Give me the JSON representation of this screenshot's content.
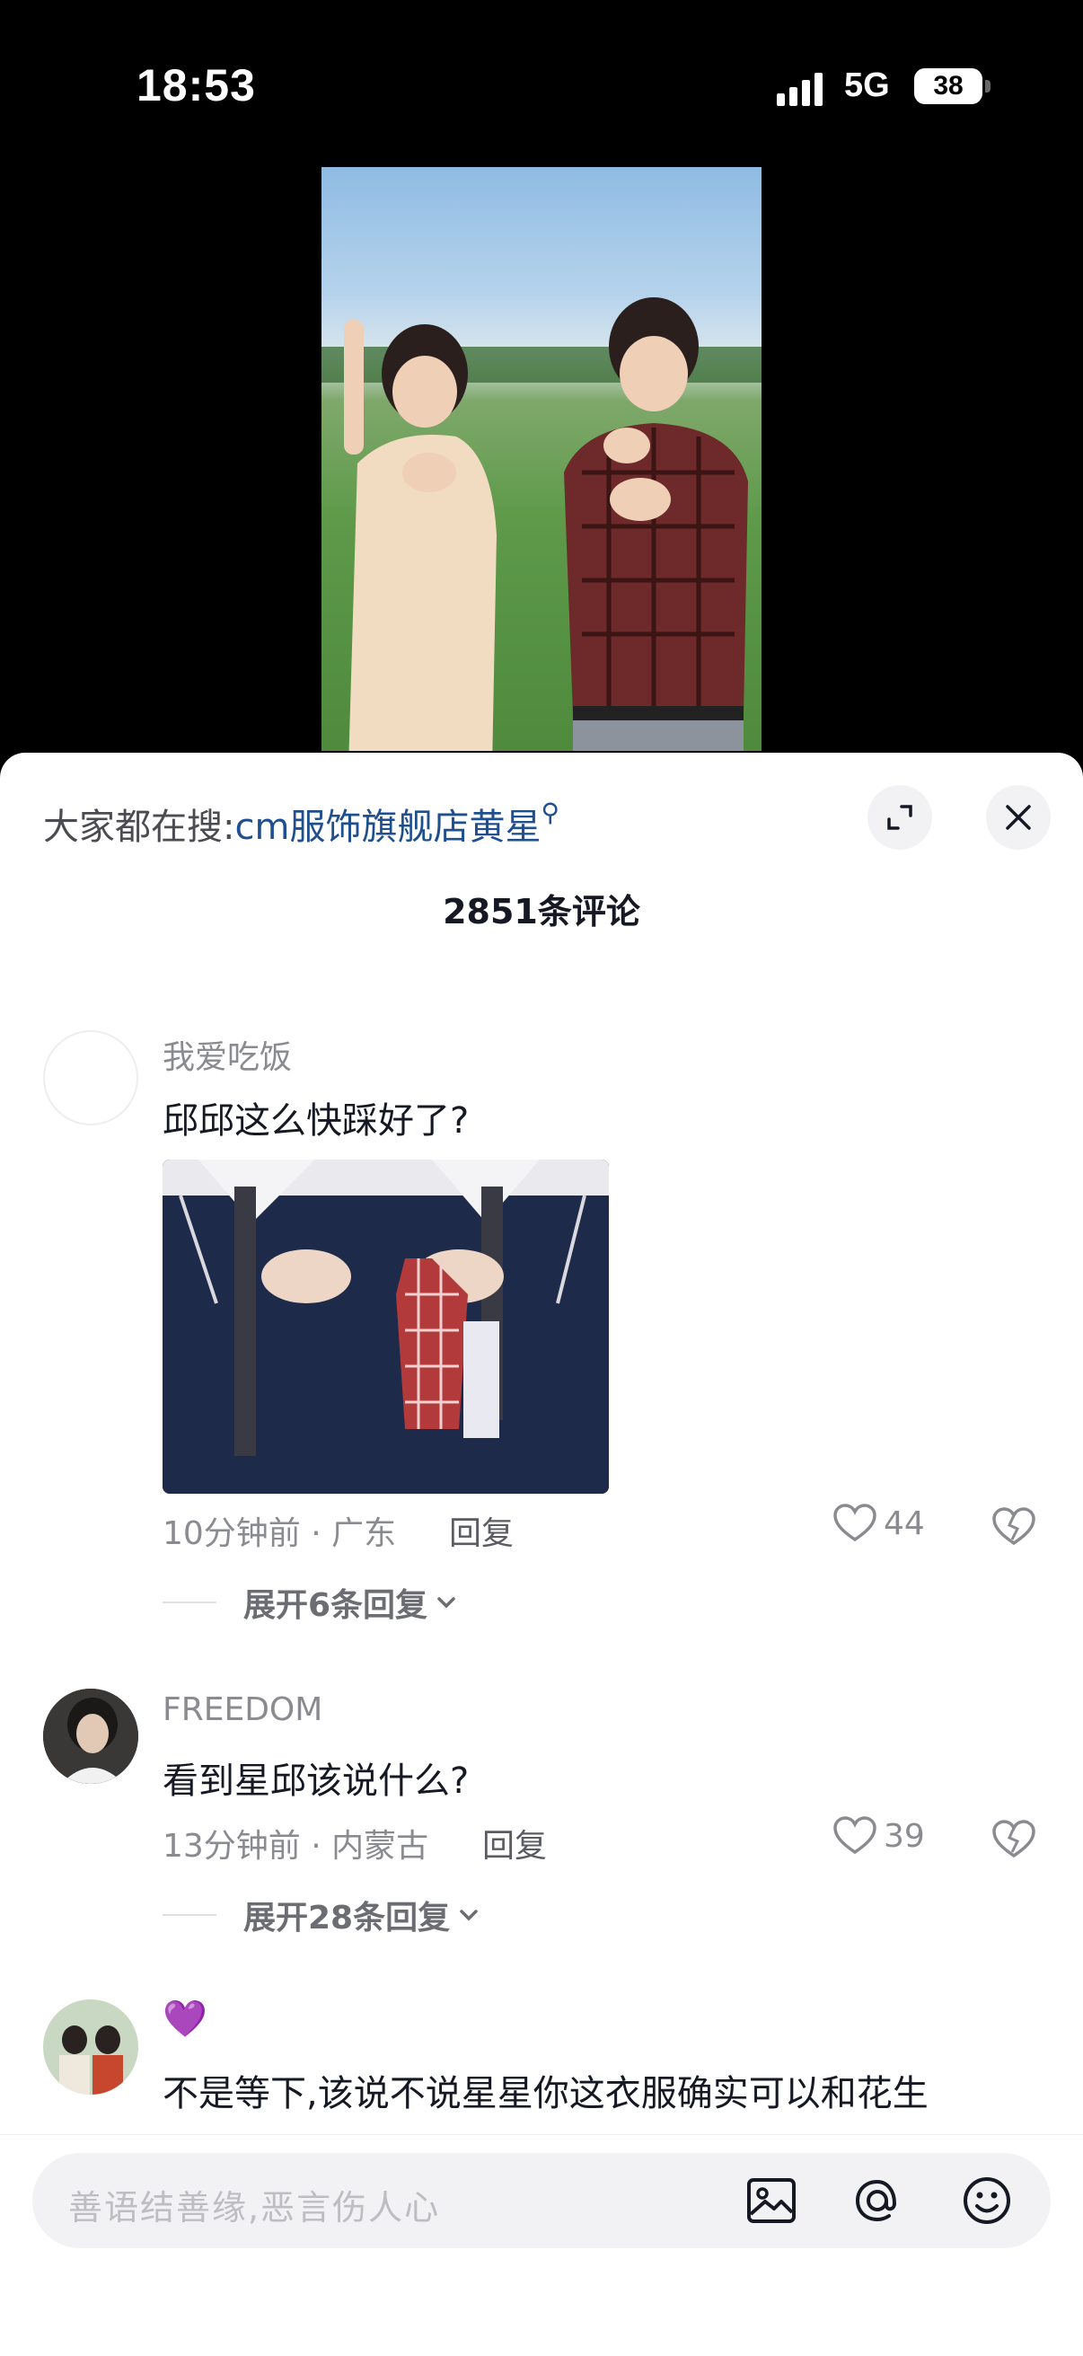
{
  "status_bar": {
    "time": "18:53",
    "network": "5G",
    "battery": "38"
  },
  "search_hint": {
    "prefix": "大家都在搜:",
    "keyword": "cm服饰旗舰店黄星"
  },
  "comments_count": "2851条评论",
  "comments": [
    {
      "username": "我爱吃饭",
      "text": "邱邱这么快踩好了?",
      "meta": "10分钟前 · 广东",
      "reply_label": "回复",
      "likes": "44",
      "expand_label": "展开6条回复"
    },
    {
      "username": "FREEDOM",
      "text": "看到星邱该说什么?",
      "meta": "13分钟前 · 内蒙古",
      "reply_label": "回复",
      "likes": "39",
      "expand_label": "展开28条回复"
    },
    {
      "username": "💜",
      "text": "不是等下,该说不说星星你这衣服确实可以和花生"
    }
  ],
  "input": {
    "placeholder": "善语结善缘,恶言伤人心"
  },
  "icons": [
    "expand-icon",
    "close-icon",
    "heart-icon",
    "broken-heart-icon",
    "image-icon",
    "at-icon",
    "emoji-icon",
    "chevron-down-icon",
    "search-icon"
  ],
  "colors": {
    "accent_link": "#1f4f8f",
    "text_primary": "#161823",
    "text_secondary": "#8a8b91"
  }
}
